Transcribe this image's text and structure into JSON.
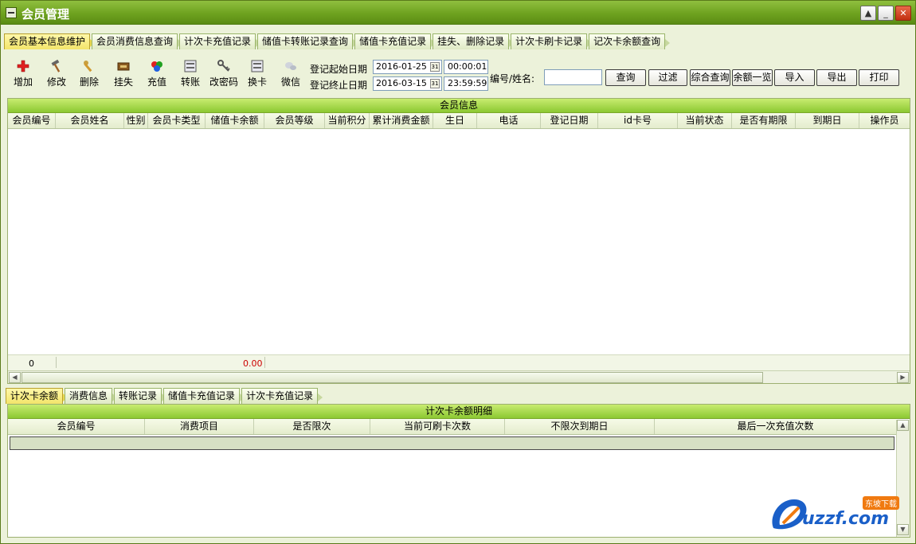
{
  "window": {
    "title": "会员管理",
    "buttons": [
      "▲",
      "_",
      "✕"
    ]
  },
  "main_tabs": [
    "会员基本信息维护",
    "会员消费信息查询",
    "计次卡充值记录",
    "储值卡转账记录查询",
    "储值卡充值记录",
    "挂失、删除记录",
    "计次卡刷卡记录",
    "记次卡余额查询"
  ],
  "toolbar": {
    "buttons": [
      {
        "label": "增加",
        "icon": "add-icon"
      },
      {
        "label": "修改",
        "icon": "hammer-icon"
      },
      {
        "label": "删除",
        "icon": "wrench-icon"
      },
      {
        "label": "挂失",
        "icon": "card-lock-icon"
      },
      {
        "label": "充值",
        "icon": "recharge-icon"
      },
      {
        "label": "转账",
        "icon": "transfer-icon"
      },
      {
        "label": "改密码",
        "icon": "key-icon"
      },
      {
        "label": "换卡",
        "icon": "card-swap-icon"
      },
      {
        "label": "微信",
        "icon": "wechat-icon"
      }
    ],
    "start_label": "登记起始日期",
    "end_label": "登记终止日期",
    "start_date": "2016-01-25",
    "start_time": "00:00:01",
    "end_date": "2016-03-15",
    "end_time": "23:59:59",
    "search_label": "编号/姓名:",
    "search_value": "",
    "actions": [
      "查询",
      "过滤",
      "综合查询",
      "余额一览",
      "导入",
      "导出",
      "打印"
    ]
  },
  "member_panel": {
    "title": "会员信息",
    "columns": [
      "会员编号",
      "会员姓名",
      "性别",
      "会员卡类型",
      "储值卡余额",
      "会员等级",
      "当前积分",
      "累计消费金额",
      "生日",
      "电话",
      "登记日期",
      "id卡号",
      "当前状态",
      "是否有期限",
      "到期日",
      "操作员"
    ],
    "footer_count": "0",
    "footer_balance": "0.00"
  },
  "sub_tabs": [
    "计次卡余额",
    "消费信息",
    "转账记录",
    "储值卡充值记录",
    "计次卡充值记录"
  ],
  "detail_panel": {
    "title": "计次卡余额明细",
    "columns": [
      "会员编号",
      "消费项目",
      "是否限次",
      "当前可刷卡次数",
      "不限次到期日",
      "最后一次充值次数"
    ]
  },
  "watermark": {
    "text": "uzzf.com",
    "badge": "东坡下载"
  },
  "colors": {
    "accent": "#8cc832",
    "titlebar": "#6ea21f",
    "balance": "#cc0000"
  }
}
